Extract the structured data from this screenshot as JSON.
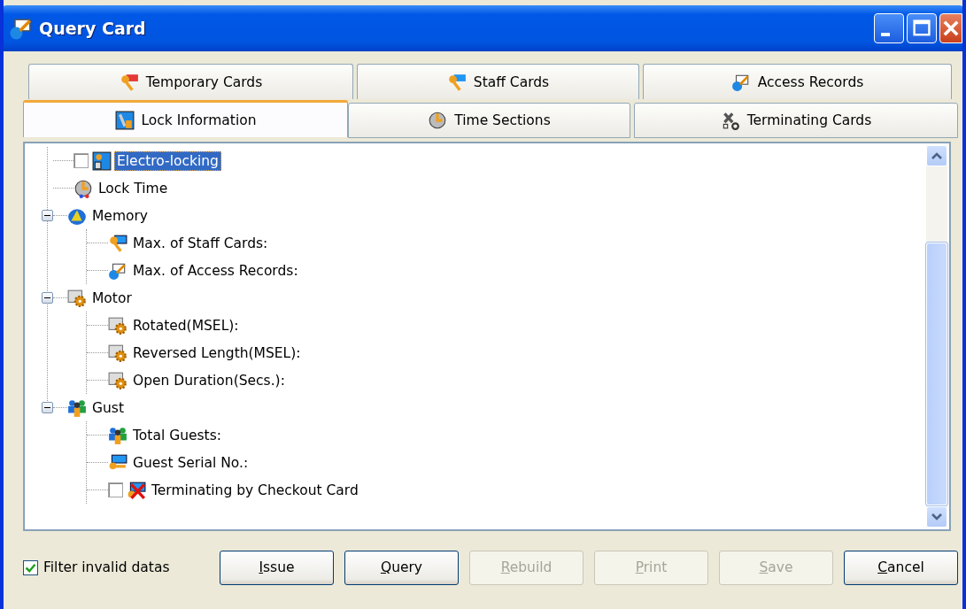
{
  "window": {
    "title": "Query Card"
  },
  "tabs": [
    [
      {
        "label": "Temporary Cards",
        "selected": false
      },
      {
        "label": "Staff Cards",
        "selected": false
      },
      {
        "label": "Access Records",
        "selected": false
      }
    ],
    [
      {
        "label": "Lock Information",
        "selected": true
      },
      {
        "label": "Time Sections",
        "selected": false
      },
      {
        "label": "Terminating Cards",
        "selected": false
      }
    ]
  ],
  "tree": {
    "items": [
      {
        "label": "Electro-locking",
        "kind": "checkbox",
        "checked": false,
        "selected": true
      },
      {
        "label": "Lock Time",
        "kind": "plain",
        "selected": false
      },
      {
        "label": "Memory",
        "kind": "plain",
        "selected": false,
        "expanded": true,
        "children": [
          {
            "label": "Max. of Staff Cards:",
            "kind": "plain",
            "selected": false
          },
          {
            "label": "Max. of Access Records:",
            "kind": "plain",
            "selected": false
          }
        ]
      },
      {
        "label": "Motor",
        "kind": "plain",
        "selected": false,
        "expanded": true,
        "children": [
          {
            "label": "Rotated(MSEL):",
            "kind": "plain",
            "selected": false
          },
          {
            "label": "Reversed Length(MSEL):",
            "kind": "plain",
            "selected": false
          },
          {
            "label": "Open Duration(Secs.):",
            "kind": "plain",
            "selected": false
          }
        ]
      },
      {
        "label": "Gust",
        "kind": "plain",
        "selected": false,
        "expanded": true,
        "children": [
          {
            "label": "Total Guests:",
            "kind": "plain",
            "selected": false
          },
          {
            "label": "Guest Serial No.:",
            "kind": "plain",
            "selected": false
          },
          {
            "label": "Terminating by Checkout Card",
            "kind": "checkbox",
            "checked": false,
            "selected": false
          }
        ]
      }
    ]
  },
  "filter": {
    "label": "Filter invalid datas",
    "checked": true
  },
  "buttons": [
    {
      "label": "Issue",
      "disabled": false
    },
    {
      "label": "Query",
      "disabled": false
    },
    {
      "label": "Rebuild",
      "disabled": true
    },
    {
      "label": "Print",
      "disabled": true
    },
    {
      "label": "Save",
      "disabled": true
    },
    {
      "label": "Cancel",
      "disabled": false
    }
  ]
}
